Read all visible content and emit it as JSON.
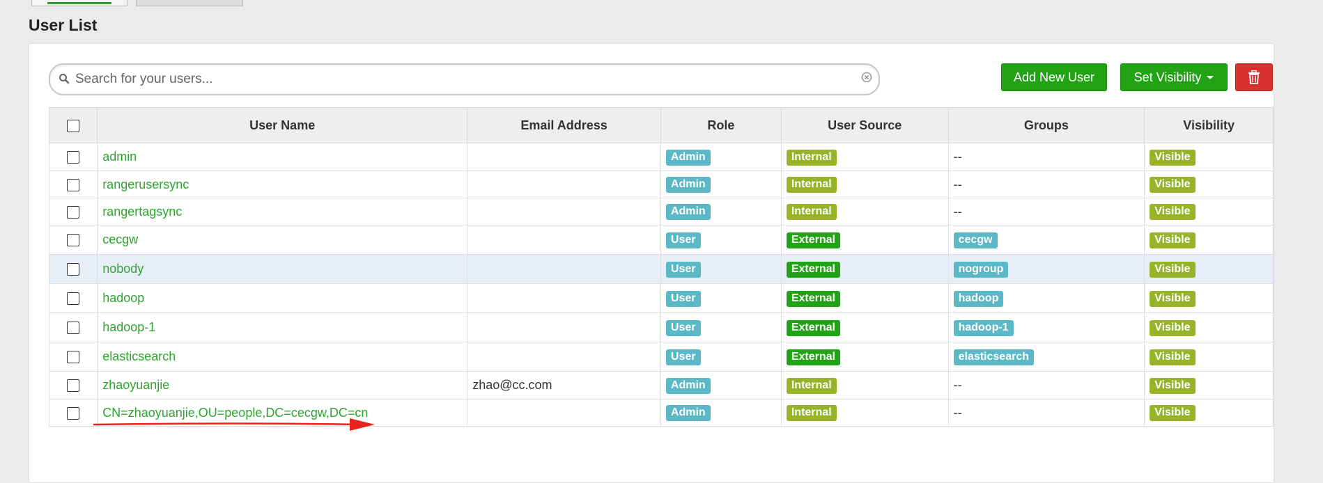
{
  "page": {
    "title": "User List"
  },
  "search": {
    "placeholder": "Search for your users..."
  },
  "toolbar": {
    "add_label": "Add New User",
    "visibility_label": "Set Visibility",
    "delete_icon": "trash-icon"
  },
  "table": {
    "columns": [
      "User Name",
      "Email Address",
      "Role",
      "User Source",
      "Groups",
      "Visibility"
    ],
    "rows": [
      {
        "name": "admin",
        "email": "",
        "role": "Admin",
        "source": "Internal",
        "group": "--",
        "visibility": "Visible"
      },
      {
        "name": "rangerusersync",
        "email": "",
        "role": "Admin",
        "source": "Internal",
        "group": "--",
        "visibility": "Visible"
      },
      {
        "name": "rangertagsync",
        "email": "",
        "role": "Admin",
        "source": "Internal",
        "group": "--",
        "visibility": "Visible"
      },
      {
        "name": "cecgw",
        "email": "",
        "role": "User",
        "source": "External",
        "group": "cecgw",
        "visibility": "Visible"
      },
      {
        "name": "nobody",
        "email": "",
        "role": "User",
        "source": "External",
        "group": "nogroup",
        "visibility": "Visible"
      },
      {
        "name": "hadoop",
        "email": "",
        "role": "User",
        "source": "External",
        "group": "hadoop",
        "visibility": "Visible"
      },
      {
        "name": "hadoop-1",
        "email": "",
        "role": "User",
        "source": "External",
        "group": "hadoop-1",
        "visibility": "Visible"
      },
      {
        "name": "elasticsearch",
        "email": "",
        "role": "User",
        "source": "External",
        "group": "elasticsearch",
        "visibility": "Visible"
      },
      {
        "name": "zhaoyuanjie",
        "email": "zhao@cc.com",
        "role": "Admin",
        "source": "Internal",
        "group": "--",
        "visibility": "Visible"
      },
      {
        "name": "CN=zhaoyuanjie,OU=people,DC=cecgw,DC=cn",
        "email": "",
        "role": "Admin",
        "source": "Internal",
        "group": "--",
        "visibility": "Visible"
      }
    ]
  },
  "colors": {
    "accent_green": "#22a316",
    "link_green": "#2ea52e",
    "badge_blue": "#5bb8c6",
    "badge_olive": "#98b327",
    "danger_red": "#d9312f",
    "annotation_arrow": "#e8231d"
  }
}
